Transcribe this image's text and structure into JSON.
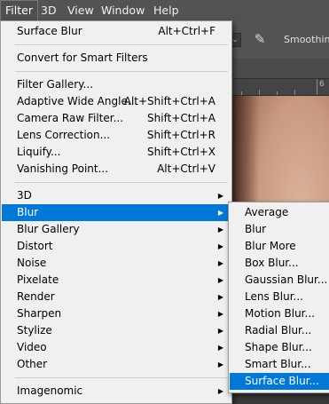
{
  "menubar": {
    "items": [
      {
        "label": "Filter",
        "active": true
      },
      {
        "label": "3D",
        "active": false
      },
      {
        "label": "View",
        "active": false
      },
      {
        "label": "Window",
        "active": false
      },
      {
        "label": "Help",
        "active": false
      }
    ]
  },
  "options_bar": {
    "smoothing_label": "Smoothing:",
    "dropdown_glyph": "⌄",
    "brush_glyph": "✎"
  },
  "ruler": {
    "mark": "6"
  },
  "filter_menu": {
    "items": [
      {
        "label": "Surface Blur",
        "shortcut": "Alt+Ctrl+F"
      },
      {
        "label": "Convert for Smart Filters",
        "shortcut": ""
      },
      {
        "label": "Filter Gallery...",
        "shortcut": ""
      },
      {
        "label": "Adaptive Wide Angle...",
        "shortcut": "Alt+Shift+Ctrl+A"
      },
      {
        "label": "Camera Raw Filter...",
        "shortcut": "Shift+Ctrl+A"
      },
      {
        "label": "Lens Correction...",
        "shortcut": "Shift+Ctrl+R"
      },
      {
        "label": "Liquify...",
        "shortcut": "Shift+Ctrl+X"
      },
      {
        "label": "Vanishing Point...",
        "shortcut": "Alt+Ctrl+V"
      },
      {
        "label": "3D",
        "submenu": true
      },
      {
        "label": "Blur",
        "submenu": true,
        "highlight": true
      },
      {
        "label": "Blur Gallery",
        "submenu": true
      },
      {
        "label": "Distort",
        "submenu": true
      },
      {
        "label": "Noise",
        "submenu": true
      },
      {
        "label": "Pixelate",
        "submenu": true
      },
      {
        "label": "Render",
        "submenu": true
      },
      {
        "label": "Sharpen",
        "submenu": true
      },
      {
        "label": "Stylize",
        "submenu": true
      },
      {
        "label": "Video",
        "submenu": true
      },
      {
        "label": "Other",
        "submenu": true
      },
      {
        "label": "Imagenomic",
        "submenu": true
      }
    ]
  },
  "blur_menu": {
    "items": [
      {
        "label": "Average"
      },
      {
        "label": "Blur"
      },
      {
        "label": "Blur More"
      },
      {
        "label": "Box Blur..."
      },
      {
        "label": "Gaussian Blur..."
      },
      {
        "label": "Lens Blur..."
      },
      {
        "label": "Motion Blur..."
      },
      {
        "label": "Radial Blur..."
      },
      {
        "label": "Shape Blur..."
      },
      {
        "label": "Smart Blur..."
      },
      {
        "label": "Surface Blur...",
        "highlight": true
      }
    ]
  },
  "colors": {
    "highlight": "#0078d7",
    "menu_bg": "#f0f0f0",
    "menubar_bg": "#535353"
  }
}
